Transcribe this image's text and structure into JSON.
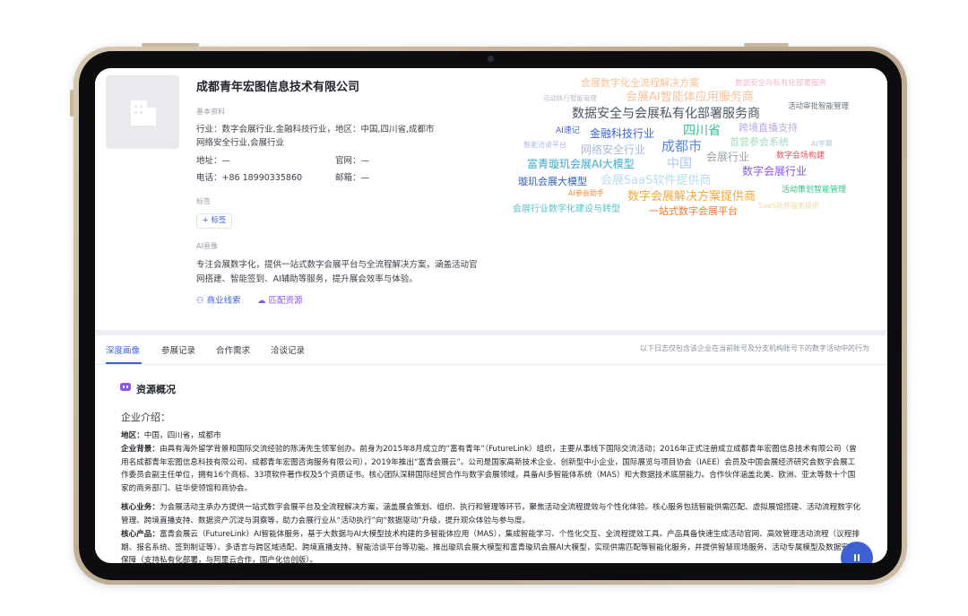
{
  "company": {
    "name": "成都青年宏图信息技术有限公司",
    "basic_label": "基本资料",
    "industry": "行业：数字会展行业,金融科技行业，",
    "industry2": "网络安全行业,会展行业",
    "region": "地区：中国,四川省,成都市",
    "address": "地址：—",
    "website": "官网：—",
    "phone": "电话：+86 18990335860",
    "email": "邮箱：—",
    "tag_label": "标签",
    "tag_add": "+ 标签",
    "ai_label": "AI画像",
    "ai_desc": "专注会展数字化，提供一站式数字会展平台与全流程解决方案，涵盖活动官网搭建、智能签到、AI辅助等服务，提升展会效率与体验。",
    "link_business": "商业线索",
    "link_match": "匹配资源"
  },
  "wordcloud": [
    {
      "t": "会展数字化全流程解决方案",
      "c": "#f6c39a"
    },
    {
      "t": "数据安全与私有化部署服务",
      "c": "#f4b8c8"
    },
    {
      "t": "活动执行智能管理",
      "c": "#b9bcc4"
    },
    {
      "t": "会展AI智能体应用服务商",
      "c": "#f6c29c"
    },
    {
      "t": "活动审批智能管理",
      "c": "#6b7280"
    },
    {
      "t": "数据安全与会展私有化部署服务商",
      "c": "#4b5563"
    },
    {
      "t": "AI速记",
      "c": "#3e62d6"
    },
    {
      "t": "金融科技行业",
      "c": "#3e62d6"
    },
    {
      "t": "四川省",
      "c": "#34c28a"
    },
    {
      "t": "跨境直播支持",
      "c": "#b9a8e4"
    },
    {
      "t": "智能洽谈平台",
      "c": "#a8b9e8"
    },
    {
      "t": "网络安全行业",
      "c": "#aab8d8"
    },
    {
      "t": "成都市",
      "c": "#5b86e5"
    },
    {
      "t": "首营参会系统",
      "c": "#a8d8c0"
    },
    {
      "t": "AI字幕",
      "c": "#a8c8e8"
    },
    {
      "t": "数字会场构建",
      "c": "#e5505a"
    },
    {
      "t": "会展行业",
      "c": "#9aa0a8"
    },
    {
      "t": "中国",
      "c": "#b0c4ec"
    },
    {
      "t": "富青璇玑会展AI大模型",
      "c": "#3aa8c8"
    },
    {
      "t": "数字会展行业",
      "c": "#8a55e6"
    },
    {
      "t": "会展SaaS软件提供商",
      "c": "#b8dcec"
    },
    {
      "t": "璇玑会展大模型",
      "c": "#2f5fbf"
    },
    {
      "t": "活动策划智能管理",
      "c": "#34c28a"
    },
    {
      "t": "AI参会助手",
      "c": "#f08a3c"
    },
    {
      "t": "数字会展解决方案提供商",
      "c": "#f2a93b"
    },
    {
      "t": "会展行业数字化建设与转型",
      "c": "#5bc0c8"
    },
    {
      "t": "一站式数字会展平台",
      "c": "#f07a35"
    },
    {
      "t": "SaaS软件服务提供",
      "c": "#f6d8a0"
    }
  ],
  "tabs": [
    "深度画像",
    "参展记录",
    "合作需求",
    "洽谈记录"
  ],
  "tab_note": "以下日志仅包含该企业在当前账号及分支机构账号下的数字活动中的行为",
  "section_title": "资源概况",
  "intro_title": "企业介绍：",
  "paragraphs": {
    "region_label": "地区：",
    "region_text": "中国，四川省，成都市",
    "background_label": "企业背景：",
    "background_text": "由具有海外留学背景和国际交流经验的陈涛先生领军创办。前身为2015年8月成立的“富有青年”（FutureLink）组织，主要从事线下国际交流活动；2016年正式注册成立成都青年宏图信息技术有限公司（曾用名成都青年宏图信息科技有限公司、成都青年宏图咨询服务有限公司），2019年推出“富青会展云”。公司是国家高新技术企业、创新型中小企业，国际展览与项目协会（IAEE）会员及中国会展经济研究会数字会展工作委员会副主任单位，拥有16个商标、33项软件著作权及5个资质证书。核心团队深耕国际经贸合作与数字会展领域，具备AI多智能体系统（MAS）和大数据技术底层能力。合作伙伴涵盖北美、欧洲、亚太等数十个国家的商务部门、驻华使领馆和商协会。",
    "core_label": "核心业务：",
    "core_text": "为会展活动主承办方提供一站式数字会展平台及全流程解决方案，涵盖展会策划、组织、执行和管理等环节，聚焦活动全流程提效与个性化体验。核心服务包括智能供需匹配、虚拟展馆搭建、活动流程数字化管理、跨境直播支持、数据资产沉淀与洞察等，助力会展行业从“活动执行”向“数据驱动”升级，提升观众体验与参与度。",
    "product_label": "核心产品：",
    "product_text": "富青会展云（FutureLink）AI智能体服务，基于大数据与AI大模型技术构建的多智能体应用（MAS），集成智能学习、个性化交互、全流程提效工具。产品具备快速生成活动官网、高效管理活动流程（议程排期、报名系统、签到制证等）、多语言与跨区域适配、跨境直播支持、智能洽谈平台等功能。推出璇玑会展大模型和富青璇玑会展AI大模型，实现供需匹配等智能化服务，并提供智慧现场服务、活动专属模型及数据安全保障（支持私有化部署，与阿里云合作，国产化信创版）。"
  }
}
